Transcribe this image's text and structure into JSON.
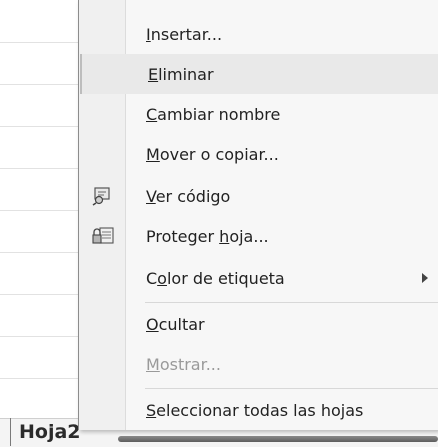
{
  "sheet_tab": {
    "label": "Hoja2"
  },
  "context_menu": {
    "items": [
      {
        "pre": "",
        "key": "I",
        "post": "nsertar...",
        "icon": ""
      },
      {
        "pre": "",
        "key": "E",
        "post": "liminar",
        "icon": ""
      },
      {
        "pre": "",
        "key": "C",
        "post": "ambiar nombre",
        "icon": ""
      },
      {
        "pre": "",
        "key": "M",
        "post": "over o copiar...",
        "icon": ""
      },
      {
        "pre": "",
        "key": "V",
        "post": "er código",
        "icon": "view-code-icon"
      },
      {
        "pre": "Proteger ",
        "key": "h",
        "post": "oja...",
        "icon": "protect-sheet-icon"
      },
      {
        "pre": "C",
        "key": "o",
        "post": "lor de etiqueta",
        "icon": "",
        "submenu": true
      },
      {
        "pre": "",
        "key": "O",
        "post": "cultar",
        "icon": ""
      },
      {
        "pre": "",
        "key": "M",
        "post": "ostrar...",
        "icon": "",
        "disabled": true
      },
      {
        "pre": "",
        "key": "S",
        "post": "eleccionar todas las hojas",
        "icon": ""
      }
    ]
  }
}
